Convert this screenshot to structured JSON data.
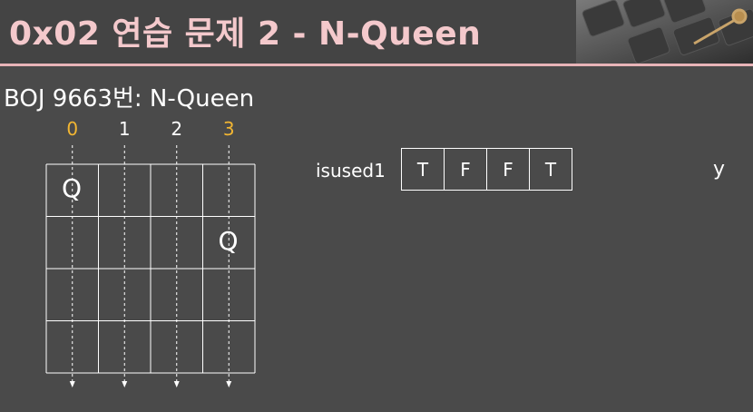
{
  "slide": {
    "title": "0x02  연습 문제 2 - N-Queen",
    "subtitle": "BOJ 9663번: N-Queen",
    "column_labels": [
      {
        "text": "0",
        "color": "#f2b632"
      },
      {
        "text": "1",
        "color": "#ffffff"
      },
      {
        "text": "2",
        "color": "#ffffff"
      },
      {
        "text": "3",
        "color": "#f2b632"
      }
    ],
    "board": {
      "size": 4,
      "queens": [
        {
          "row": 0,
          "col": 0,
          "text": "Q"
        },
        {
          "row": 1,
          "col": 3,
          "text": "Q"
        }
      ]
    },
    "array": {
      "label": "isused1",
      "values": [
        "T",
        "F",
        "F",
        "T"
      ]
    },
    "corner_letter": "y"
  },
  "colors": {
    "background": "#4a4a4a",
    "title": "#f4c9cc",
    "accent_line": "#e8b4b8",
    "highlight": "#f2b632"
  }
}
